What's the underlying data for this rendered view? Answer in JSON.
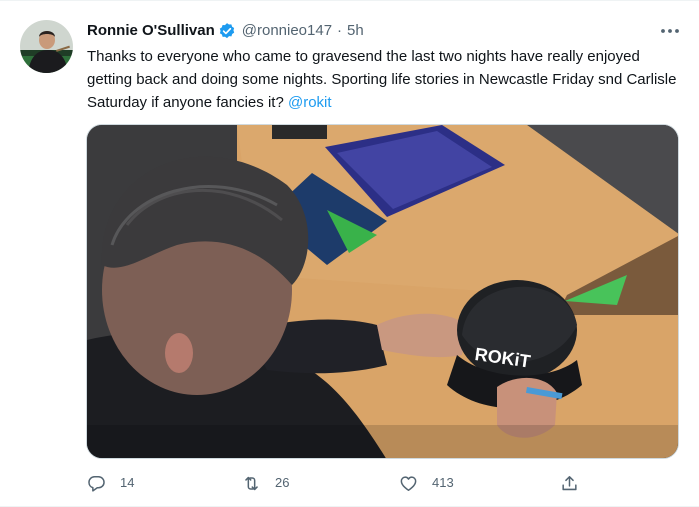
{
  "author": {
    "display_name": "Ronnie O'Sullivan",
    "handle": "@ronnieo147",
    "separator": "·",
    "time": "5h",
    "verified": true
  },
  "tweet": {
    "text": "Thanks to everyone who came to gravesend the last two nights have really enjoyed getting back and doing some nights. Sporting life stories in Newcastle Friday snd Carlisle Saturday if anyone fancies it? ",
    "mention": "@rokit"
  },
  "media": {
    "cap_text": "ROKiT"
  },
  "actions": {
    "reply_count": "14",
    "retweet_count": "26",
    "like_count": "413"
  },
  "colors": {
    "accent": "#1d9bf0",
    "secondary_text": "#536471",
    "primary_text": "#0f1419"
  },
  "icons": {
    "more": "more-icon",
    "verified": "verified-badge-icon",
    "reply": "reply-icon",
    "retweet": "retweet-icon",
    "like": "like-icon",
    "share": "share-icon"
  }
}
